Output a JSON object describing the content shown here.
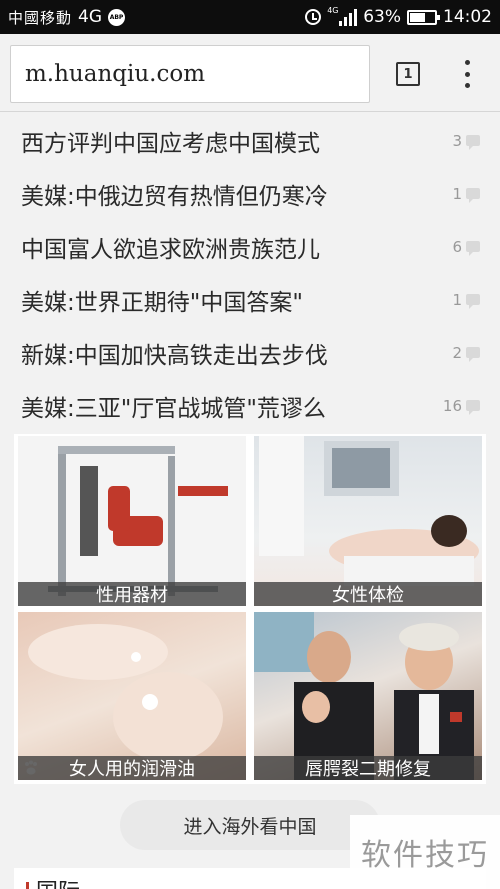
{
  "status_bar": {
    "carrier": "中國移動",
    "network": "4G",
    "adblock_badge": "ABP",
    "signal_tag": "4G",
    "battery_percent": "63%",
    "battery_level": 0.63,
    "time": "14:02"
  },
  "browser": {
    "url": "m.huanqiu.com",
    "tab_count": "1"
  },
  "headlines": [
    {
      "title": "西方评判中国应考虑中国模式",
      "comments": "3"
    },
    {
      "title": "美媒:中俄边贸有热情但仍寒冷",
      "comments": "1"
    },
    {
      "title": "中国富人欲追求欧洲贵族范儿",
      "comments": "6"
    },
    {
      "title": "美媒:世界正期待\"中国答案\"",
      "comments": "1"
    },
    {
      "title": "新媒:中国加快高铁走出去步伐",
      "comments": "2"
    },
    {
      "title": "美媒:三亚\"厅官战城管\"荒谬么",
      "comments": "16"
    }
  ],
  "image_tiles": [
    {
      "caption": "性用器材"
    },
    {
      "caption": "女性体检"
    },
    {
      "caption": "女人用的润滑油"
    },
    {
      "caption": "唇腭裂二期修复"
    }
  ],
  "enter_button": "进入海外看中国",
  "section_peek": "国际",
  "watermark": "软件技巧"
}
